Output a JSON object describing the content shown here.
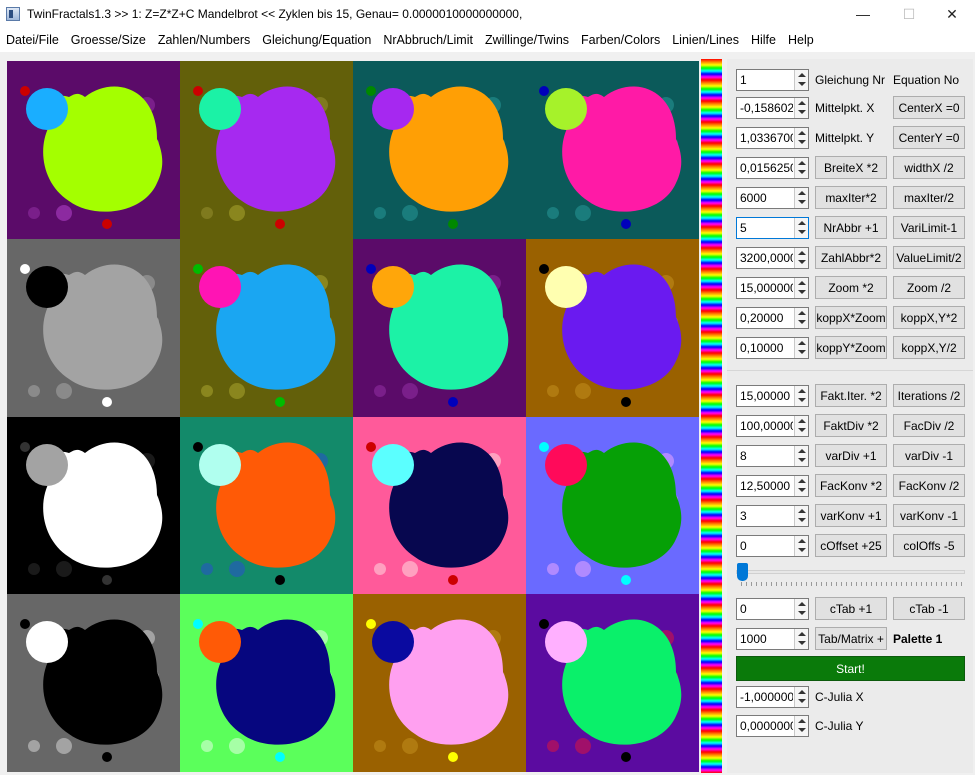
{
  "window": {
    "title": "TwinFractals1.3 >> 1: Z=Z*Z+C Mandelbrot << Zyklen bis 15, Genau= 0.0000010000000000,",
    "minimize_glyph": "—",
    "maximize_glyph": "☐",
    "close_glyph": "✕"
  },
  "menu": [
    "Datei/File",
    "Groesse/Size",
    "Zahlen/Numbers",
    "Gleichung/Equation",
    "NrAbbruch/Limit",
    "Zwillinge/Twins",
    "Farben/Colors",
    "Linien/Lines",
    "Hilfe",
    "Help"
  ],
  "tiles": [
    {
      "bg": "#5b0b69",
      "main": "#a4ff00",
      "bulb": "#1aaeff",
      "dots": [
        "#cc0000",
        "#7a1f8a",
        "#8c2aa0",
        "#8c2aa0"
      ]
    },
    {
      "bg": "#63600a",
      "main": "#a629f0",
      "bulb": "#1bf2a6",
      "dots": [
        "#cc0000",
        "#7f7a1e",
        "#8a861e",
        "#8a861e"
      ]
    },
    {
      "bg": "#0b5a5a",
      "main": "#ff9f05",
      "bulb": "#a628f0",
      "dots": [
        "#008800",
        "#1a7c7c",
        "#1a7c7c",
        "#1a7c7c"
      ]
    },
    {
      "bg": "#0b5a5a",
      "main": "#ff1aa6",
      "bulb": "#a6f22a",
      "dots": [
        "#0000bb",
        "#1a7c7c",
        "#1a7c7c",
        "#1a7c7c"
      ]
    },
    {
      "bg": "#676767",
      "main": "#a3a3a3",
      "bulb": "#000000",
      "dots": [
        "#ffffff",
        "#8a8a8a",
        "#8a8a8a",
        "#8a8a8a"
      ]
    },
    {
      "bg": "#63600a",
      "main": "#1aa6f2",
      "bulb": "#ff14b4",
      "dots": [
        "#00bb00",
        "#8a861e",
        "#8a861e",
        "#8a861e"
      ]
    },
    {
      "bg": "#5b0b69",
      "main": "#1cf2a6",
      "bulb": "#ffa60a",
      "dots": [
        "#0000bb",
        "#7a1f8a",
        "#7a1f8a",
        "#7a1f8a"
      ]
    },
    {
      "bg": "#9a6100",
      "main": "#6a1af0",
      "bulb": "#ffffb0",
      "dots": [
        "#000000",
        "#b07a10",
        "#b07a10",
        "#b07a10"
      ]
    },
    {
      "bg": "#000000",
      "main": "#ffffff",
      "bulb": "#a3a3a3",
      "dots": [
        "#333333",
        "#1a1a1a",
        "#1a1a1a",
        "#1a1a1a"
      ]
    },
    {
      "bg": "#138a6a",
      "main": "#ff5a06",
      "bulb": "#b0ffef",
      "dots": [
        "#000000",
        "#1f6aa0",
        "#1f6aa0",
        "#1f6aa0"
      ]
    },
    {
      "bg": "#ff5a9a",
      "main": "#07074f",
      "bulb": "#5bffff",
      "dots": [
        "#cc0000",
        "#ffa0c0",
        "#ffa0c0",
        "#ffa0c0"
      ]
    },
    {
      "bg": "#6a6aff",
      "main": "#06a006",
      "bulb": "#ff0a5a",
      "dots": [
        "#00ffff",
        "#b08aff",
        "#b08aff",
        "#b08aff"
      ]
    },
    {
      "bg": "#676767",
      "main": "#000000",
      "bulb": "#ffffff",
      "dots": [
        "#000000",
        "#a3a3a3",
        "#a3a3a3",
        "#a3a3a3"
      ]
    },
    {
      "bg": "#5bff5b",
      "main": "#06067f",
      "bulb": "#ff5a06",
      "dots": [
        "#00ffff",
        "#a6ffa6",
        "#a6ffa6",
        "#a6ffa6"
      ]
    },
    {
      "bg": "#9a6100",
      "main": "#ffa0f0",
      "bulb": "#0a0aa0",
      "dots": [
        "#ffff00",
        "#b07a10",
        "#b07a10",
        "#b07a10"
      ]
    },
    {
      "bg": "#5b0ba0",
      "main": "#0af06a",
      "bulb": "#ffb0ff",
      "dots": [
        "#000000",
        "#a0106a",
        "#a0106a",
        "#a0106a"
      ]
    }
  ],
  "controls": {
    "equation_value": "1",
    "equation_label": "Gleichung Nr",
    "equation_label_en": "Equation No",
    "centerx_value": "-0,158602(",
    "centerx_label": "Mittelpkt. X",
    "centerx_btn": "CenterX =0",
    "centery_value": "1,0336700",
    "centery_label": "Mittelpkt. Y",
    "centery_btn": "CenterY =0",
    "width_value": "0,0156250",
    "width_btn1": "BreiteX *2",
    "width_btn2": "widthX /2",
    "maxiter_value": "6000",
    "maxiter_btn1": "maxIter*2",
    "maxiter_btn2": "maxIter/2",
    "nrabbr_value": "5",
    "nrabbr_btn1": "NrAbbr +1",
    "nrabbr_btn2": "VariLimit-1",
    "zahlabbr_value": "3200,00000",
    "zahlabbr_btn1": "ZahlAbbr*2",
    "zahlabbr_btn2": "ValueLimit/2",
    "zoom_value": "15,000000",
    "zoom_btn1": "Zoom *2",
    "zoom_btn2": "Zoom /2",
    "koppx_value": "0,20000",
    "koppx_btn1": "koppX*Zoom",
    "koppx_btn2": "koppX,Y*2",
    "koppy_value": "0,10000",
    "koppy_btn1": "koppY*Zoom",
    "koppy_btn2": "koppX,Y/2",
    "faktiter_value": "15,00000",
    "faktiter_btn1": "Fakt.Iter. *2",
    "faktiter_btn2": "Iterations /2",
    "faktdiv_value": "100,00000",
    "faktdiv_btn1": "FaktDiv *2",
    "faktdiv_btn2": "FacDiv /2",
    "vardiv_value": "8",
    "vardiv_btn1": "varDiv +1",
    "vardiv_btn2": "varDiv -1",
    "fackonv_value": "12,50000",
    "fackonv_btn1": "FacKonv *2",
    "fackonv_btn2": "FacKonv /2",
    "varkonv_value": "3",
    "varkonv_btn1": "varKonv +1",
    "varkonv_btn2": "varKonv -1",
    "coffset_value": "0",
    "coffset_btn1": "cOffset +25",
    "coffset_btn2": "colOffs -5",
    "ctab_value": "0",
    "ctab_btn1": "cTab +1",
    "ctab_btn2": "cTab -1",
    "tabmatrix_value": "1000",
    "tabmatrix_btn": "Tab/Matrix +",
    "palette_label": "Palette 1",
    "start_btn": "Start!",
    "cjuliax_value": "-1,000000(",
    "cjuliax_label": "C-Julia X",
    "cjuliay_value": "0,0000000(",
    "cjuliay_label": "C-Julia Y"
  }
}
